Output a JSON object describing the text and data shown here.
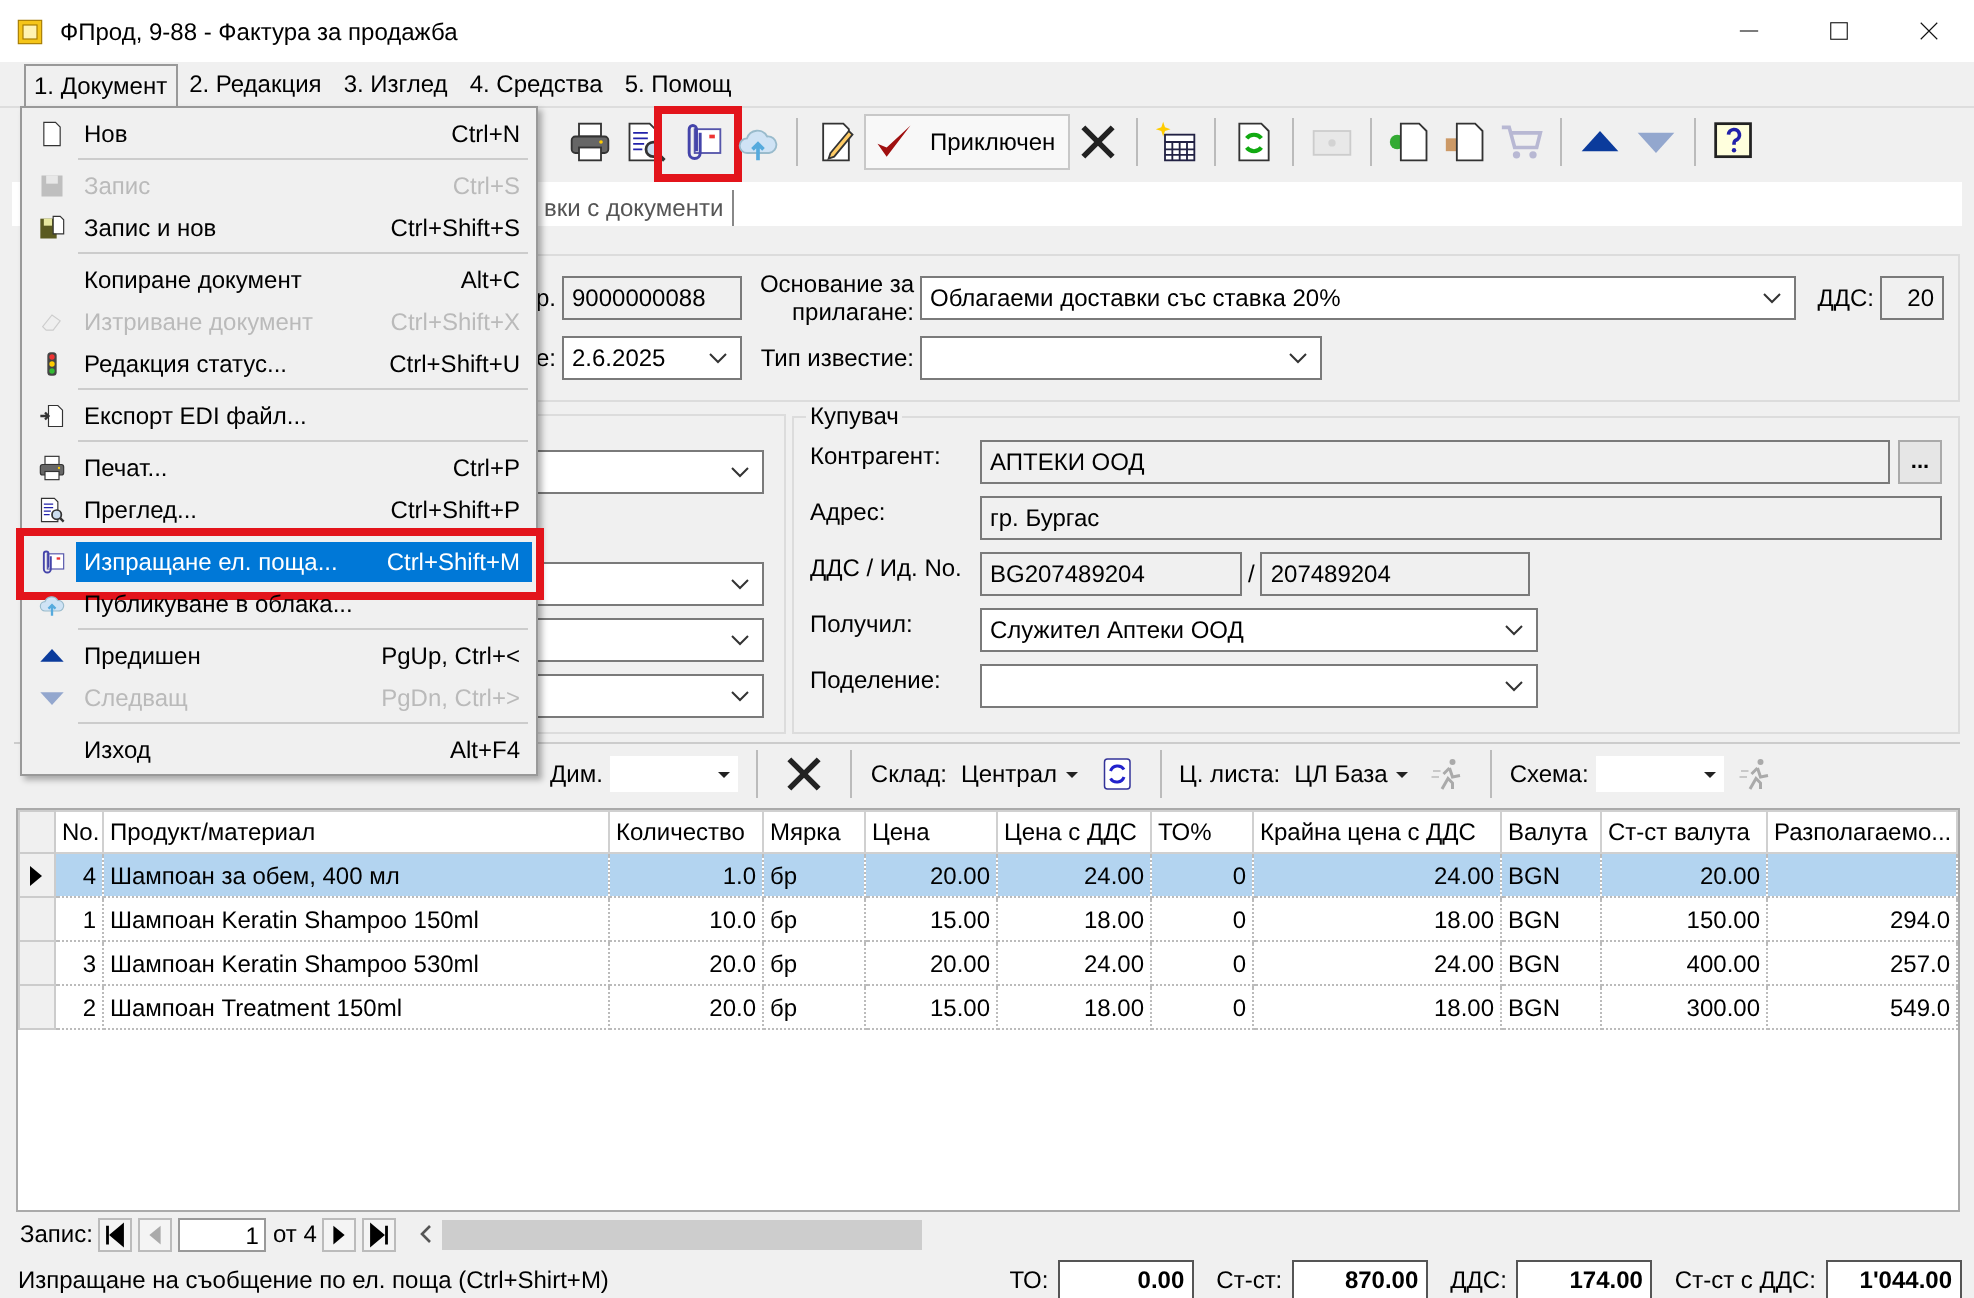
{
  "window": {
    "title": "ФПрод, 9-88 - Фактура за продажба"
  },
  "menu_bar": [
    {
      "label": "1. Документ",
      "selected": true
    },
    {
      "label": "2. Редакция",
      "selected": false
    },
    {
      "label": "3. Изглед",
      "selected": false
    },
    {
      "label": "4. Средства",
      "selected": false
    },
    {
      "label": "5. Помощ",
      "selected": false
    }
  ],
  "document_menu": [
    {
      "kind": "item",
      "label": "Нов",
      "shortcut": "Ctrl+N",
      "disabled": false,
      "selected": false,
      "marked": false
    },
    {
      "kind": "separator"
    },
    {
      "kind": "item",
      "label": "Запис",
      "shortcut": "Ctrl+S",
      "disabled": true,
      "selected": false,
      "marked": false
    },
    {
      "kind": "item",
      "label": "Запис и нов",
      "shortcut": "Ctrl+Shift+S",
      "disabled": false,
      "selected": false,
      "marked": false
    },
    {
      "kind": "separator"
    },
    {
      "kind": "item",
      "label": "Копиране документ",
      "shortcut": "Alt+C",
      "disabled": false,
      "selected": false,
      "marked": false
    },
    {
      "kind": "item",
      "label": "Изтриване документ",
      "shortcut": "Ctrl+Shift+X",
      "disabled": true,
      "selected": false,
      "marked": false
    },
    {
      "kind": "item",
      "label": "Редакция статус...",
      "shortcut": "Ctrl+Shift+U",
      "disabled": false,
      "selected": false,
      "marked": false
    },
    {
      "kind": "separator"
    },
    {
      "kind": "item",
      "label": "Експорт EDI файл...",
      "disabled": false,
      "selected": false,
      "marked": false
    },
    {
      "kind": "separator"
    },
    {
      "kind": "item",
      "label": "Печат...",
      "shortcut": "Ctrl+P",
      "disabled": false,
      "selected": false,
      "marked": false
    },
    {
      "kind": "item",
      "label": "Преглед...",
      "shortcut": "Ctrl+Shift+P",
      "disabled": false,
      "selected": false,
      "marked": false
    },
    {
      "kind": "separator"
    },
    {
      "kind": "item",
      "label": "Изпращане ел. поща...",
      "shortcut": "Ctrl+Shift+M",
      "disabled": false,
      "selected": true,
      "marked": true
    },
    {
      "kind": "item",
      "label": "Публикуване в облака...",
      "disabled": false,
      "selected": false,
      "marked": false
    },
    {
      "kind": "separator"
    },
    {
      "kind": "item",
      "label": "Предишен",
      "shortcut": "PgUp, Ctrl+<",
      "disabled": false,
      "selected": false,
      "marked": false
    },
    {
      "kind": "item",
      "label": "Следващ",
      "shortcut": "PgDn, Ctrl+>",
      "disabled": true,
      "selected": false,
      "marked": false
    },
    {
      "kind": "separator"
    },
    {
      "kind": "item",
      "label": "Изход",
      "shortcut": "Alt+F4",
      "disabled": false,
      "selected": false,
      "marked": false
    }
  ],
  "toolbar": [
    {
      "kind": "icon",
      "disabled": false
    },
    {
      "kind": "icon",
      "disabled": false
    },
    {
      "kind": "icon",
      "disabled": false,
      "marked": true
    },
    {
      "kind": "icon",
      "disabled": false
    },
    {
      "kind": "separator"
    },
    {
      "kind": "icon",
      "disabled": false
    },
    {
      "kind": "button",
      "label": "Приключен",
      "pressed": true
    },
    {
      "kind": "icon",
      "disabled": false
    },
    {
      "kind": "separator"
    },
    {
      "kind": "icon",
      "disabled": false
    },
    {
      "kind": "separator"
    },
    {
      "kind": "icon",
      "disabled": false
    },
    {
      "kind": "separator"
    },
    {
      "kind": "icon",
      "disabled": true
    },
    {
      "kind": "separator"
    },
    {
      "kind": "icon",
      "disabled": false
    },
    {
      "kind": "icon",
      "disabled": false
    },
    {
      "kind": "icon",
      "disabled": true
    },
    {
      "kind": "separator"
    },
    {
      "kind": "icon",
      "disabled": false
    },
    {
      "kind": "icon",
      "disabled": true
    },
    {
      "kind": "separator"
    },
    {
      "kind": "icon",
      "disabled": false
    }
  ],
  "tabs": [
    {
      "label": "вки с документи",
      "selected": false
    }
  ],
  "document": {
    "number_label": "р.",
    "number": "9000000088",
    "date_label": "е:",
    "date": "2.6.2025",
    "basis_label": "Основание за прилагане:",
    "basis": "Облагаеми доставки със ставка 20%",
    "vat_label": "ДДС:",
    "vat": "20",
    "notice_label": "Тип известие:"
  },
  "buyer": {
    "title": "Купувач",
    "partner_label": "Контрагент:",
    "partner": "АПТЕКИ ООД",
    "browse": "...",
    "address_label": "Адрес:",
    "address": "гр. Бургас",
    "vat_id_label": "ДДС / Ид. No.",
    "vat_number": "BG207489204",
    "separator": "/",
    "id_number": "207489204",
    "received_label": "Получил:",
    "received": "Служител Аптеки ООД",
    "division_label": "Поделение:"
  },
  "grid_toolbar": {
    "dim_label": "Дим.",
    "warehouse_label": "Склад:",
    "warehouse": "Централ",
    "price_list_label": "Ц. листа:",
    "price_list": "ЦЛ База",
    "scheme_label": "Схема:"
  },
  "table": {
    "columns": [
      "No.",
      "Продукт/материал",
      "Количество",
      "Мярка",
      "Цена",
      "Цена с ДДС",
      "ТО%",
      "Крайна цена с ДДС",
      "Валута",
      "Ст-ст валута",
      "Разполагаемо..."
    ],
    "rows": [
      {
        "selected": true,
        "cells": [
          "4",
          "Шампоан за обем, 400 мл",
          "1.0",
          "бр",
          "20.00",
          "24.00",
          "0",
          "24.00",
          "BGN",
          "20.00"
        ]
      },
      {
        "selected": false,
        "cells": [
          "1",
          "Шампоан Keratin Shampoo 150ml",
          "10.0",
          "бр",
          "15.00",
          "18.00",
          "0",
          "18.00",
          "BGN",
          "150.00",
          "294.0"
        ]
      },
      {
        "selected": false,
        "cells": [
          "3",
          "Шампоан Keratin Shampoo 530ml",
          "20.0",
          "бр",
          "20.00",
          "24.00",
          "0",
          "24.00",
          "BGN",
          "400.00",
          "257.0"
        ]
      },
      {
        "selected": false,
        "cells": [
          "2",
          "Шампоан Treatment 150ml",
          "20.0",
          "бр",
          "15.00",
          "18.00",
          "0",
          "18.00",
          "BGN",
          "300.00",
          "549.0"
        ]
      }
    ]
  },
  "navigator": {
    "label": "Запис:",
    "record": "1",
    "of": "от 4"
  },
  "status_bar": {
    "message": "Изпращане на съобщение по ел. поща (Ctrl+Shirt+M)",
    "totals": [
      {
        "label": "ТО:",
        "value": "0.00"
      },
      {
        "label": "Ст-ст:",
        "value": "870.00"
      },
      {
        "label": "ДДС:",
        "value": "174.00"
      },
      {
        "label": "Ст-ст с ДДС:",
        "value": "1'044.00"
      }
    ]
  }
}
